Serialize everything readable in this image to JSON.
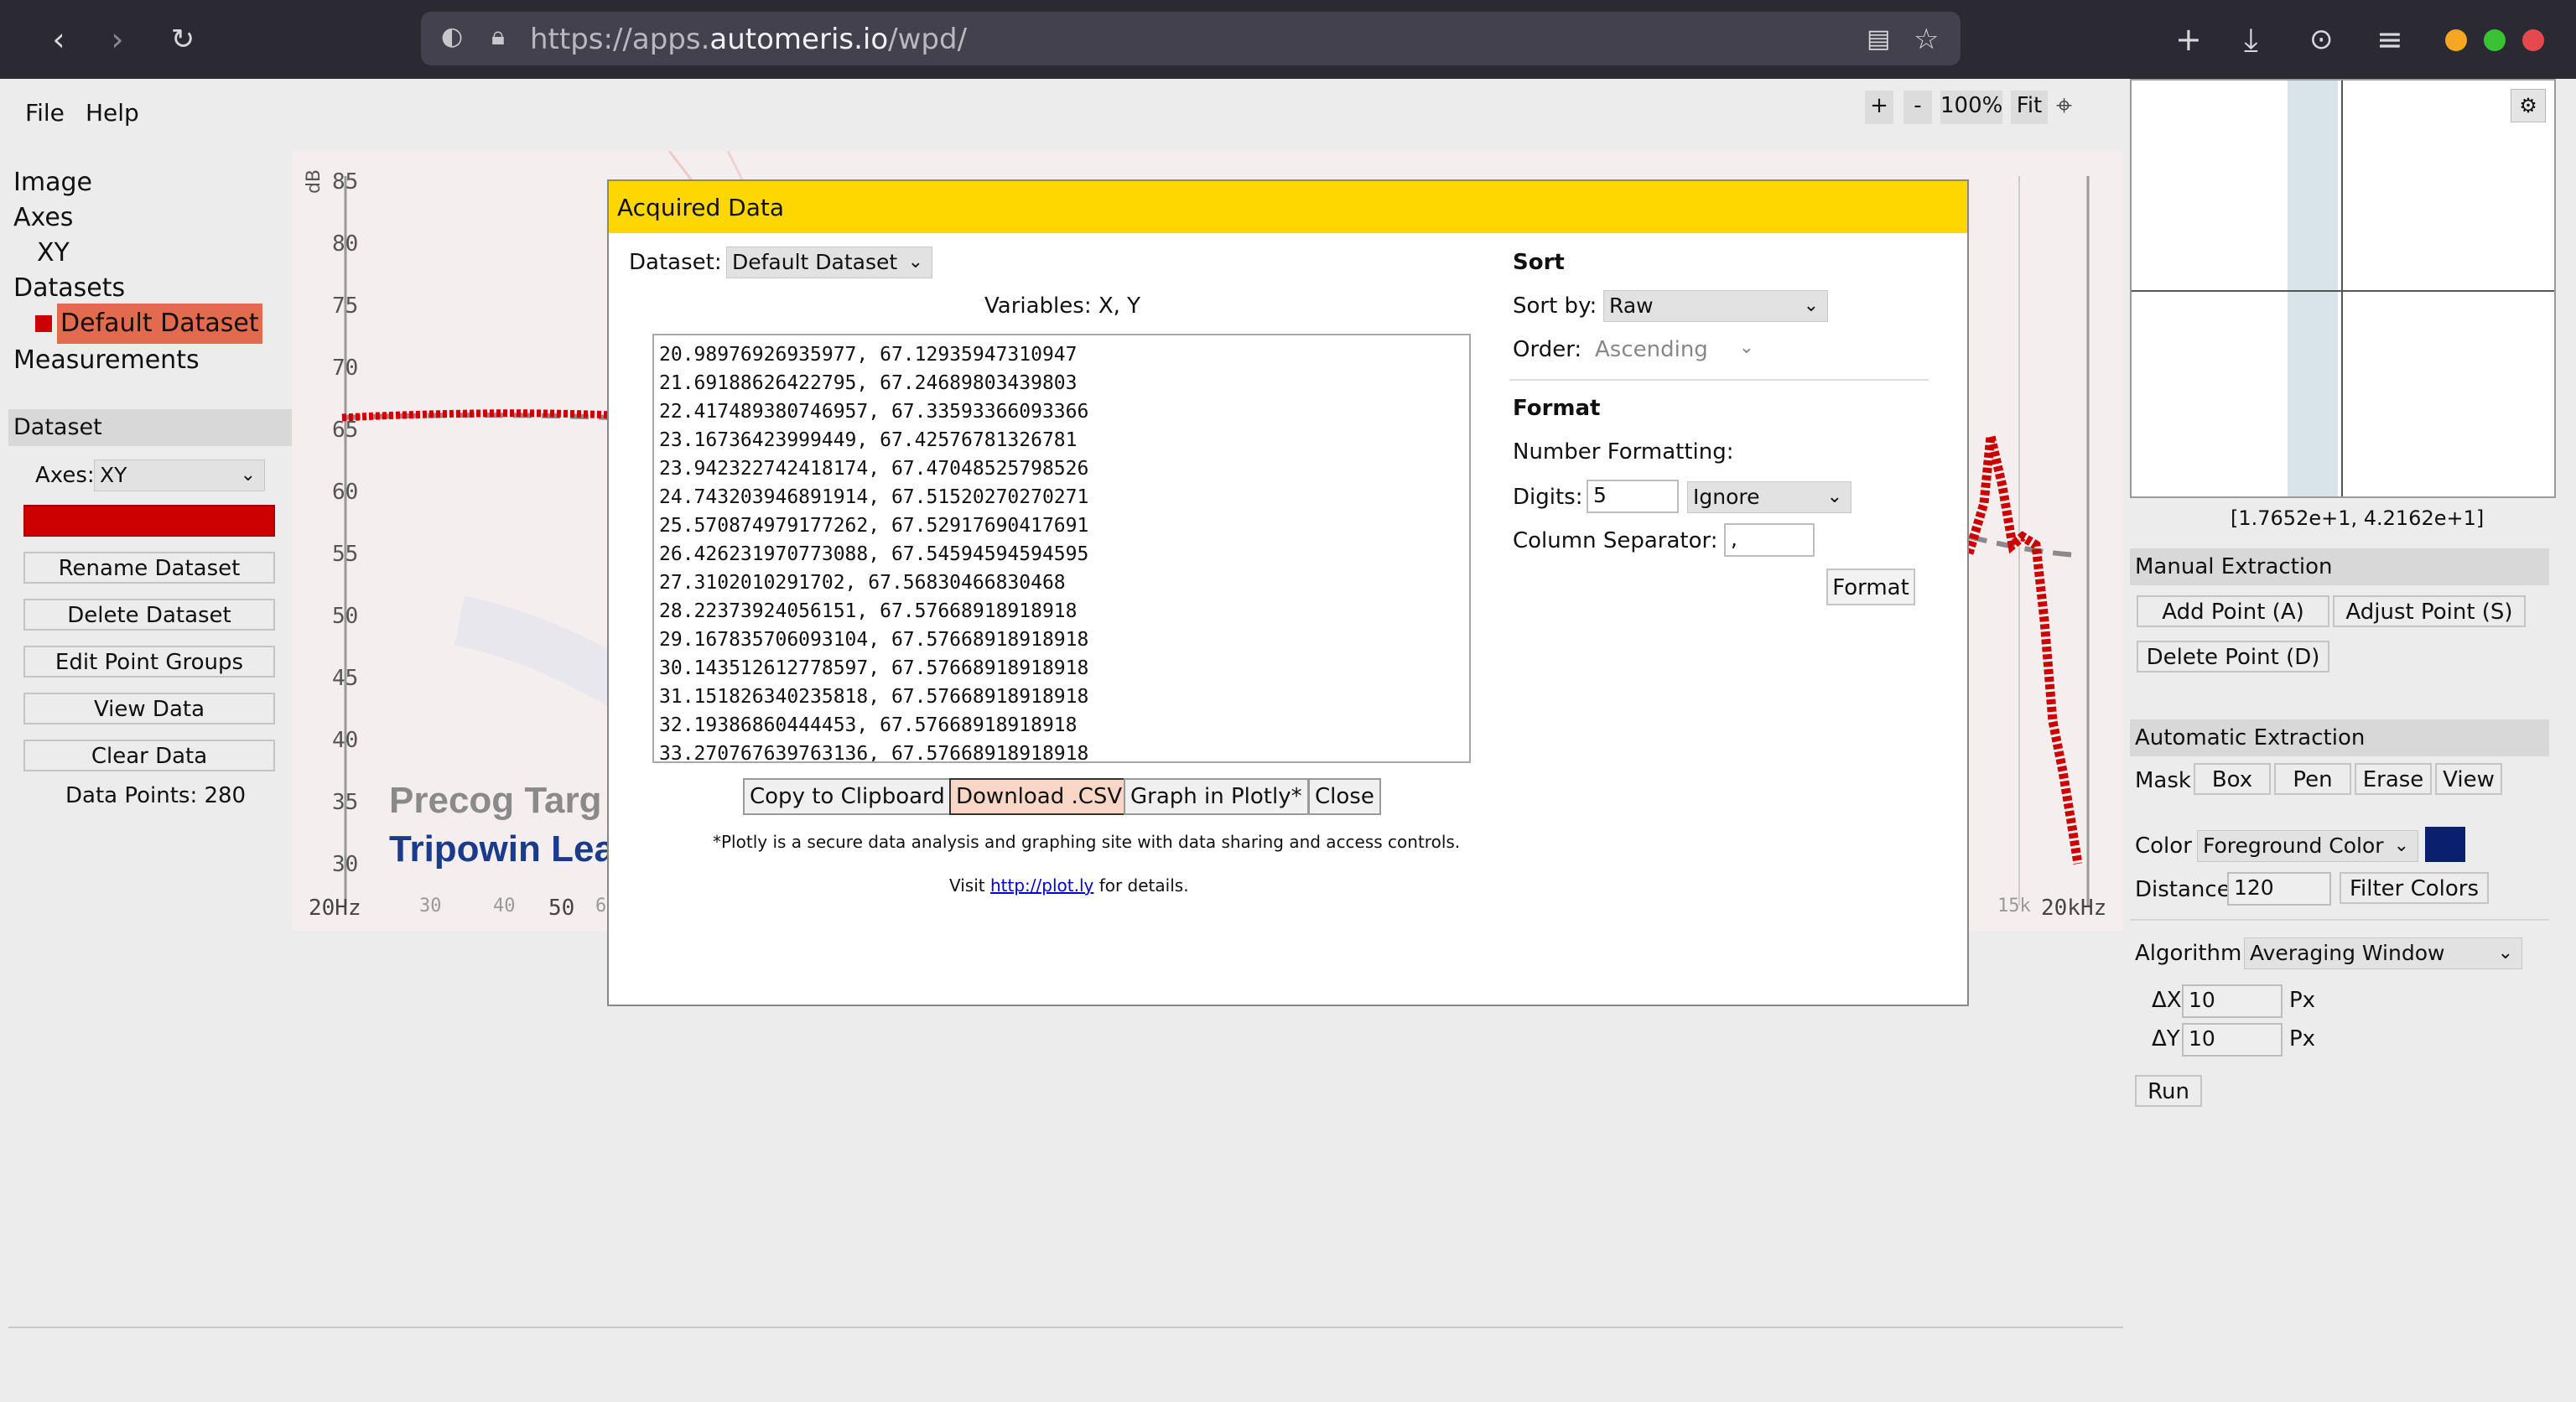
{
  "browser": {
    "url_prefix": "https://apps.",
    "url_domain": "automeris.io",
    "url_path": "/wpd/"
  },
  "menu": {
    "file": "File",
    "help": "Help"
  },
  "tree": {
    "image": "Image",
    "axes": "Axes",
    "axes_xy": "XY",
    "datasets": "Datasets",
    "default_dataset": "Default Dataset",
    "measurements": "Measurements"
  },
  "dataset_panel": {
    "header": "Dataset",
    "axes_label": "Axes:",
    "axes_value": "XY",
    "display_color": "Display Color",
    "rename": "Rename Dataset",
    "delete": "Delete Dataset",
    "edit_groups": "Edit Point Groups",
    "view_data": "View Data",
    "clear_data": "Clear Data",
    "data_points": "Data Points: 280"
  },
  "toolbar": {
    "zoom_in": "+",
    "zoom_out": "-",
    "zoom_level": "100%",
    "fit": "Fit"
  },
  "graph": {
    "yunit": "dB",
    "yticks": [
      "85",
      "80",
      "75",
      "70",
      "65",
      "60",
      "55",
      "50",
      "45",
      "40",
      "35",
      "30"
    ],
    "xticks_left": [
      "20Hz",
      "30",
      "40",
      "50",
      "6"
    ],
    "xticks_right": [
      "15k",
      "20kHz"
    ],
    "legend1": "Precog Targ",
    "legend2": "Tripowin Lea"
  },
  "modal": {
    "title": "Acquired Data",
    "dataset_label": "Dataset:",
    "dataset_value": "Default Dataset",
    "variables": "Variables: X, Y",
    "rows": [
      "20.98976926935977, 67.12935947310947",
      "21.69188626422795, 67.24689803439803",
      "22.417489380746957, 67.33593366093366",
      "23.16736423999449, 67.42576781326781",
      "23.942322742418174, 67.47048525798526",
      "24.743203946891914, 67.51520270270271",
      "25.570874979177262, 67.52917690417691",
      "26.426231970773088, 67.54594594594595",
      "27.3102010291702, 67.56830466830468",
      "28.22373924056151, 67.57668918918918",
      "29.167835706093104, 67.57668918918918",
      "30.143512612778597, 67.57668918918918",
      "31.151826340235818, 67.57668918918918",
      "32.19386860444453, 67.57668918918918",
      "33.270767639763136, 67.57668918918918"
    ],
    "copy": "Copy to Clipboard",
    "download": "Download .CSV",
    "plotly": "Graph in Plotly*",
    "close": "Close",
    "plotly_note": "*Plotly is a secure data analysis and graphing site with data sharing and access controls.",
    "visit_pre": "Visit",
    "visit_link": "http://plot.ly",
    "visit_post": "for details.",
    "sort_header": "Sort",
    "sort_by_label": "Sort by:",
    "sort_by_value": "Raw",
    "order_label": "Order:",
    "order_value": "Ascending",
    "format_header": "Format",
    "number_formatting": "Number Formatting:",
    "digits_label": "Digits:",
    "digits_value": "5",
    "digits_mode": "Ignore",
    "column_sep_label": "Column Separator:",
    "column_sep_value": ",",
    "format_button": "Format"
  },
  "right_panel": {
    "coords": "[1.7652e+1, 4.2162e+1]",
    "manual_header": "Manual Extraction",
    "add_point": "Add Point (A)",
    "adjust_point": "Adjust Point (S)",
    "delete_point": "Delete Point (D)",
    "auto_header": "Automatic Extraction",
    "mask_label": "Mask",
    "box": "Box",
    "pen": "Pen",
    "erase": "Erase",
    "view": "View",
    "color_label": "Color",
    "color_value": "Foreground Color",
    "distance_label": "Distance",
    "distance_value": "120",
    "filter_colors": "Filter Colors",
    "algorithm_label": "Algorithm",
    "algorithm_value": "Averaging Window",
    "dx_label": "ΔX",
    "dx_value": "10",
    "dy_label": "ΔY",
    "dy_value": "10",
    "px": "Px",
    "run": "Run"
  },
  "colors": {
    "modal_title_bg": "#ffd700",
    "dataset_color": "#cc0000",
    "foreground_color": "#0a1f6e",
    "chrome_bg": "#2b2a33"
  }
}
